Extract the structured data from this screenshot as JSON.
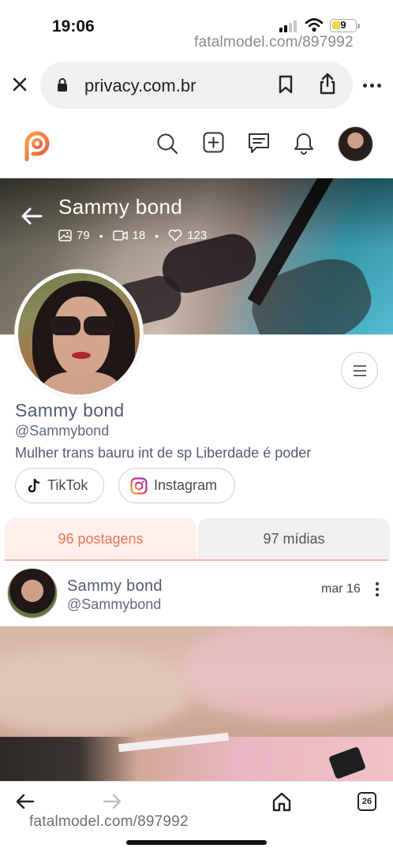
{
  "status_bar": {
    "time": "19:06",
    "battery": "9"
  },
  "watermark": {
    "top": "fatalmodel.com/897992",
    "bottom": "fatalmodel.com/897992"
  },
  "browser": {
    "url": "privacy.com.br",
    "open_tabs": "26"
  },
  "banner": {
    "name": "Sammy bond",
    "stats": {
      "images": "79",
      "videos": "18",
      "likes": "123"
    }
  },
  "profile": {
    "name": "Sammy bond",
    "handle": "@Sammybond",
    "bio": "Mulher trans bauru int de sp Liberdade é poder",
    "links": [
      {
        "label": "TikTok"
      },
      {
        "label": "Instagram"
      }
    ]
  },
  "tabs": [
    {
      "label": "96 postagens",
      "active": true
    },
    {
      "label": "97 mídias",
      "active": false
    }
  ],
  "post": {
    "author": "Sammy bond",
    "handle": "@Sammybond",
    "date": "mar 16"
  },
  "colors": {
    "accent": "#e57757",
    "tab_active_bg": "#fdefec",
    "name_color": "#4f5d73"
  },
  "icons": [
    "close-icon",
    "lock-icon",
    "bookmark-icon",
    "share-icon",
    "more-icon",
    "logo-icon",
    "search-icon",
    "add-icon",
    "chat-icon",
    "bell-icon",
    "back-arrow-icon",
    "image-icon",
    "video-icon",
    "heart-icon",
    "menu-icon",
    "tiktok-icon",
    "instagram-icon",
    "kebab-icon",
    "forward-icon",
    "home-icon",
    "tabs-icon"
  ]
}
